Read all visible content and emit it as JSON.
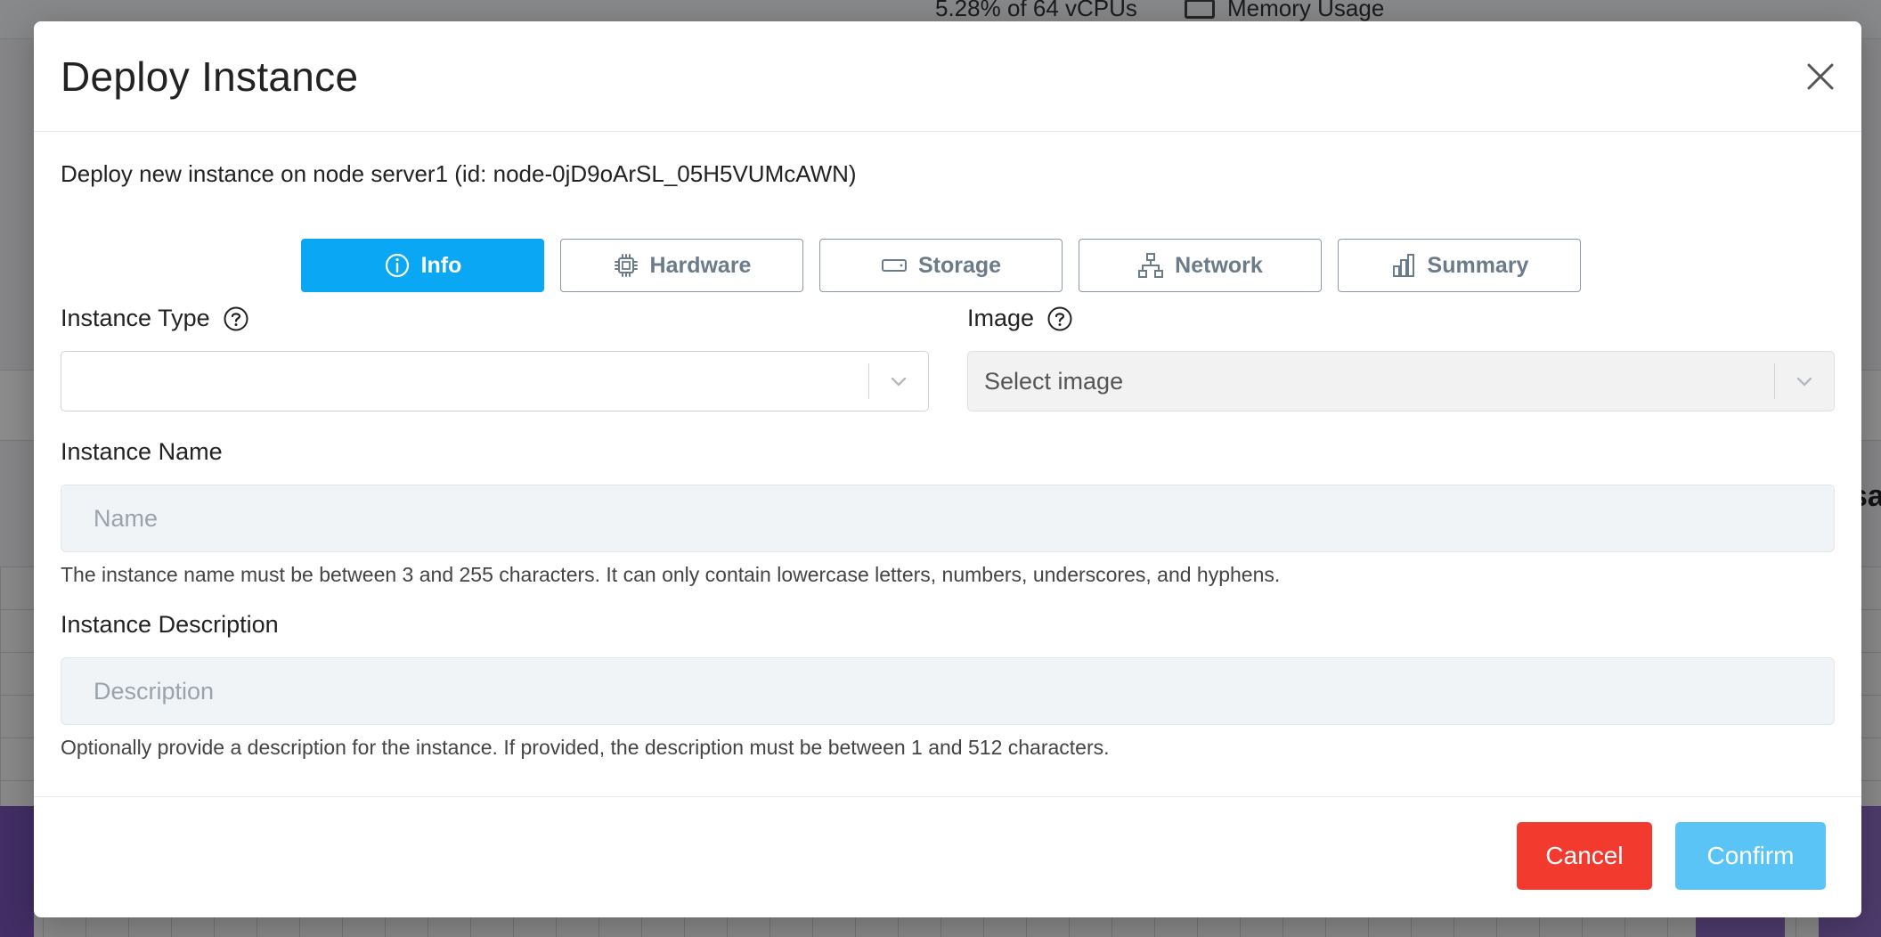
{
  "background": {
    "cpu_stat": "5.28% of 64 vCPUs",
    "memory_stat": "Memory Usage",
    "side_text": "sa"
  },
  "modal": {
    "title": "Deploy Instance",
    "subtitle": "Deploy new instance on node server1 (id: node-0jD9oArSL_05H5VUMcAWN)",
    "tabs": [
      {
        "label": "Info",
        "icon": "info-icon",
        "active": true
      },
      {
        "label": "Hardware",
        "icon": "cpu-chip-icon",
        "active": false
      },
      {
        "label": "Storage",
        "icon": "drive-icon",
        "active": false
      },
      {
        "label": "Network",
        "icon": "network-icon",
        "active": false
      },
      {
        "label": "Summary",
        "icon": "bar-chart-icon",
        "active": false
      }
    ],
    "instance_type": {
      "label": "Instance Type",
      "value": ""
    },
    "image": {
      "label": "Image",
      "placeholder": "Select image"
    },
    "instance_name": {
      "label": "Instance Name",
      "placeholder": "Name",
      "value": "",
      "hint": "The instance name must be between 3 and 255 characters. It can only contain lowercase letters, numbers, underscores, and hyphens."
    },
    "instance_description": {
      "label": "Instance Description",
      "placeholder": "Description",
      "value": "",
      "hint": "Optionally provide a description for the instance. If provided, the description must be between 1 and 512 characters."
    },
    "footer": {
      "cancel_label": "Cancel",
      "confirm_label": "Confirm"
    }
  },
  "colors": {
    "accent": "#0aa7f5",
    "cancel": "#f23a2f",
    "confirm": "#5bc4f6"
  }
}
